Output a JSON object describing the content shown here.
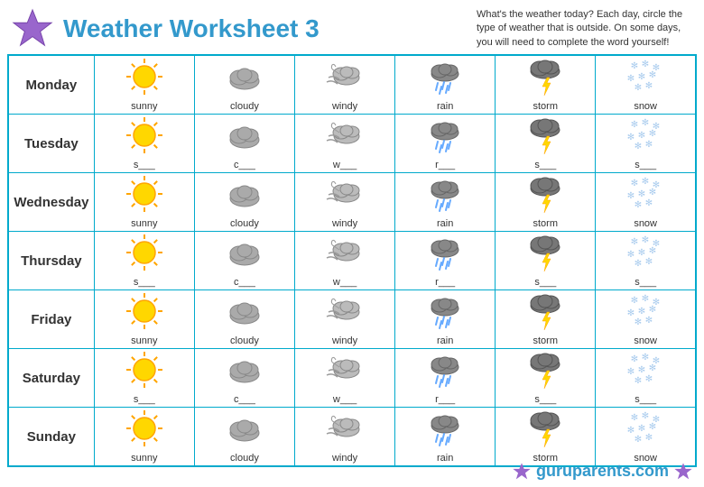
{
  "header": {
    "title": "Weather Worksheet 3",
    "instruction": "What's the weather today? Each day, circle the type of weather that is outside. On some days, you will need to complete the word yourself!"
  },
  "days": [
    {
      "name": "Monday",
      "type": "full",
      "labels": [
        "sunny",
        "cloudy",
        "windy",
        "rain",
        "storm",
        "snow"
      ]
    },
    {
      "name": "Tuesday",
      "type": "partial",
      "labels": [
        "s___",
        "c___",
        "w___",
        "r___",
        "s___",
        "s___"
      ]
    },
    {
      "name": "Wednesday",
      "type": "full",
      "labels": [
        "sunny",
        "cloudy",
        "windy",
        "rain",
        "storm",
        "snow"
      ]
    },
    {
      "name": "Thursday",
      "type": "partial",
      "labels": [
        "s___",
        "c___",
        "w___",
        "r___",
        "s___",
        "s___"
      ]
    },
    {
      "name": "Friday",
      "type": "full",
      "labels": [
        "sunny",
        "cloudy",
        "windy",
        "rain",
        "storm",
        "snow"
      ]
    },
    {
      "name": "Saturday",
      "type": "partial",
      "labels": [
        "s___",
        "c___",
        "w___",
        "r___",
        "s___",
        "s___"
      ]
    },
    {
      "name": "Sunday",
      "type": "full",
      "labels": [
        "sunny",
        "cloudy",
        "windy",
        "rain",
        "storm",
        "snow"
      ]
    }
  ],
  "footer": "guruparents.com"
}
